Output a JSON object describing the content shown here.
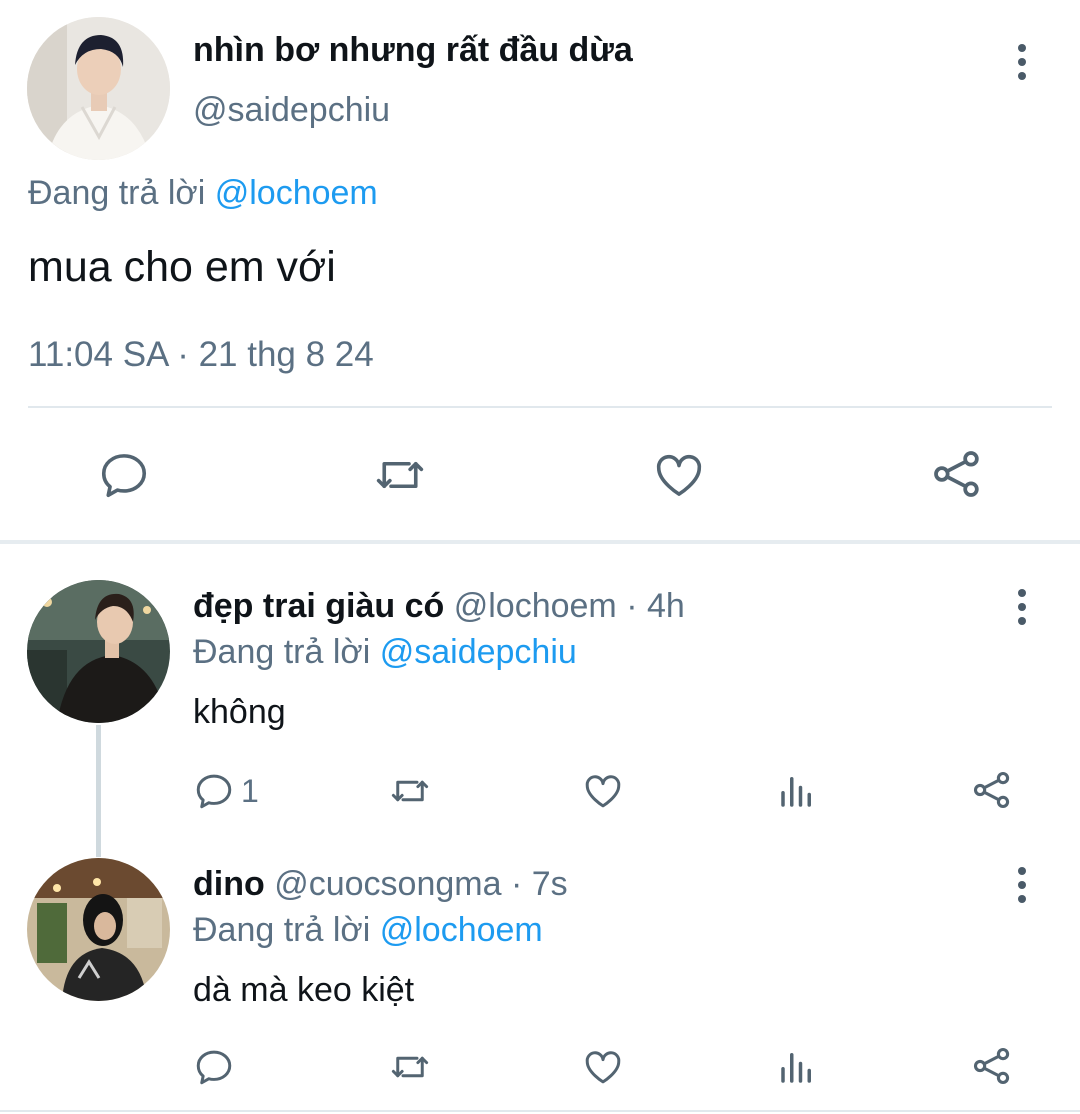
{
  "main_tweet": {
    "display_name": "nhìn bơ nhưng rất đầu dừa",
    "handle": "@saidepchiu",
    "reply_prefix": "Đang trả lời",
    "reply_to": "@lochoem",
    "text": "mua cho em với",
    "timestamp": "11:04 SA · 21 thg 8 24",
    "actions": [
      "reply-icon",
      "retweet-icon",
      "like-icon",
      "share-icon"
    ]
  },
  "replies": [
    {
      "display_name": "đẹp trai giàu có",
      "handle": "@lochoem",
      "time": "· 4h",
      "reply_prefix": "Đang trả lời",
      "reply_to": "@saidepchiu",
      "text": "không",
      "reply_count": "1"
    },
    {
      "display_name": "dino",
      "handle": "@cuocsongma",
      "time": "· 7s",
      "reply_prefix": "Đang trả lời",
      "reply_to": "@lochoem",
      "text": "dà mà keo kiệt",
      "reply_count": ""
    }
  ],
  "colors": {
    "link": "#1d9bf0",
    "muted": "#5b7083",
    "icon": "#536471",
    "divider": "#e1e8ed"
  }
}
